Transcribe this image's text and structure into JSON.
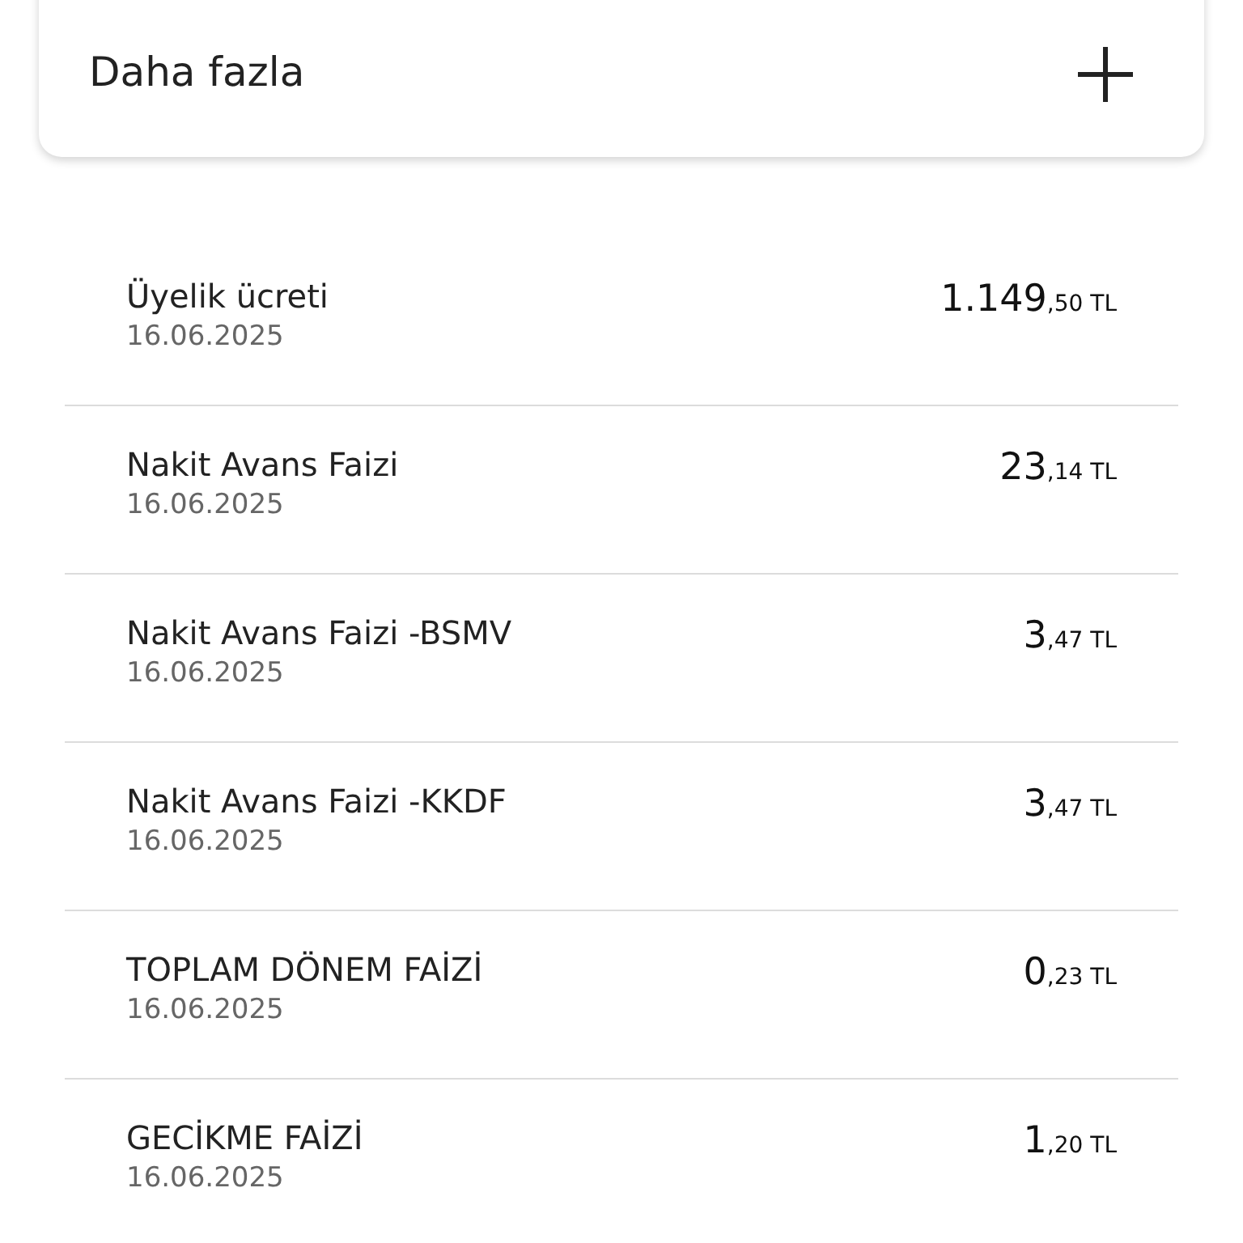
{
  "header": {
    "title": "Daha fazla"
  },
  "transactions": [
    {
      "name": "Üyelik ücreti",
      "date": "16.06.2025",
      "amount_main": "1.149",
      "amount_decimal": ",50",
      "currency": "TL"
    },
    {
      "name": "Nakit Avans Faizi",
      "date": "16.06.2025",
      "amount_main": "23",
      "amount_decimal": ",14",
      "currency": "TL"
    },
    {
      "name": "Nakit Avans Faizi -BSMV",
      "date": "16.06.2025",
      "amount_main": "3",
      "amount_decimal": ",47",
      "currency": "TL"
    },
    {
      "name": "Nakit Avans Faizi -KKDF",
      "date": "16.06.2025",
      "amount_main": "3",
      "amount_decimal": ",47",
      "currency": "TL"
    },
    {
      "name": "TOPLAM DÖNEM FAİZİ",
      "date": "16.06.2025",
      "amount_main": "0",
      "amount_decimal": ",23",
      "currency": "TL"
    },
    {
      "name": "GECİKME FAİZİ",
      "date": "16.06.2025",
      "amount_main": "1",
      "amount_decimal": ",20",
      "currency": "TL"
    }
  ]
}
